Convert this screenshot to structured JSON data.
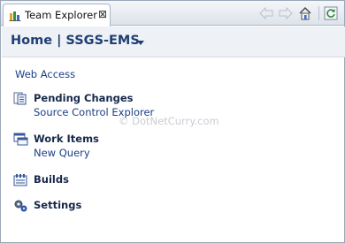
{
  "tab": {
    "title": "Team Explorer",
    "close_glyph": "⊠"
  },
  "toolbar": {
    "icons": [
      "back-arrow-icon",
      "forward-arrow-icon",
      "home-icon",
      "refresh-icon"
    ]
  },
  "header": {
    "title": "Home | SSGS-EMS"
  },
  "web_access": {
    "label": "Web Access"
  },
  "sections": {
    "pending": {
      "title": "Pending Changes",
      "link": "Source Control Explorer"
    },
    "work_items": {
      "title": "Work Items",
      "link": "New Query"
    },
    "builds": {
      "title": "Builds"
    },
    "settings": {
      "title": "Settings"
    }
  },
  "watermark": {
    "text": "© DotNetCurry.com"
  }
}
